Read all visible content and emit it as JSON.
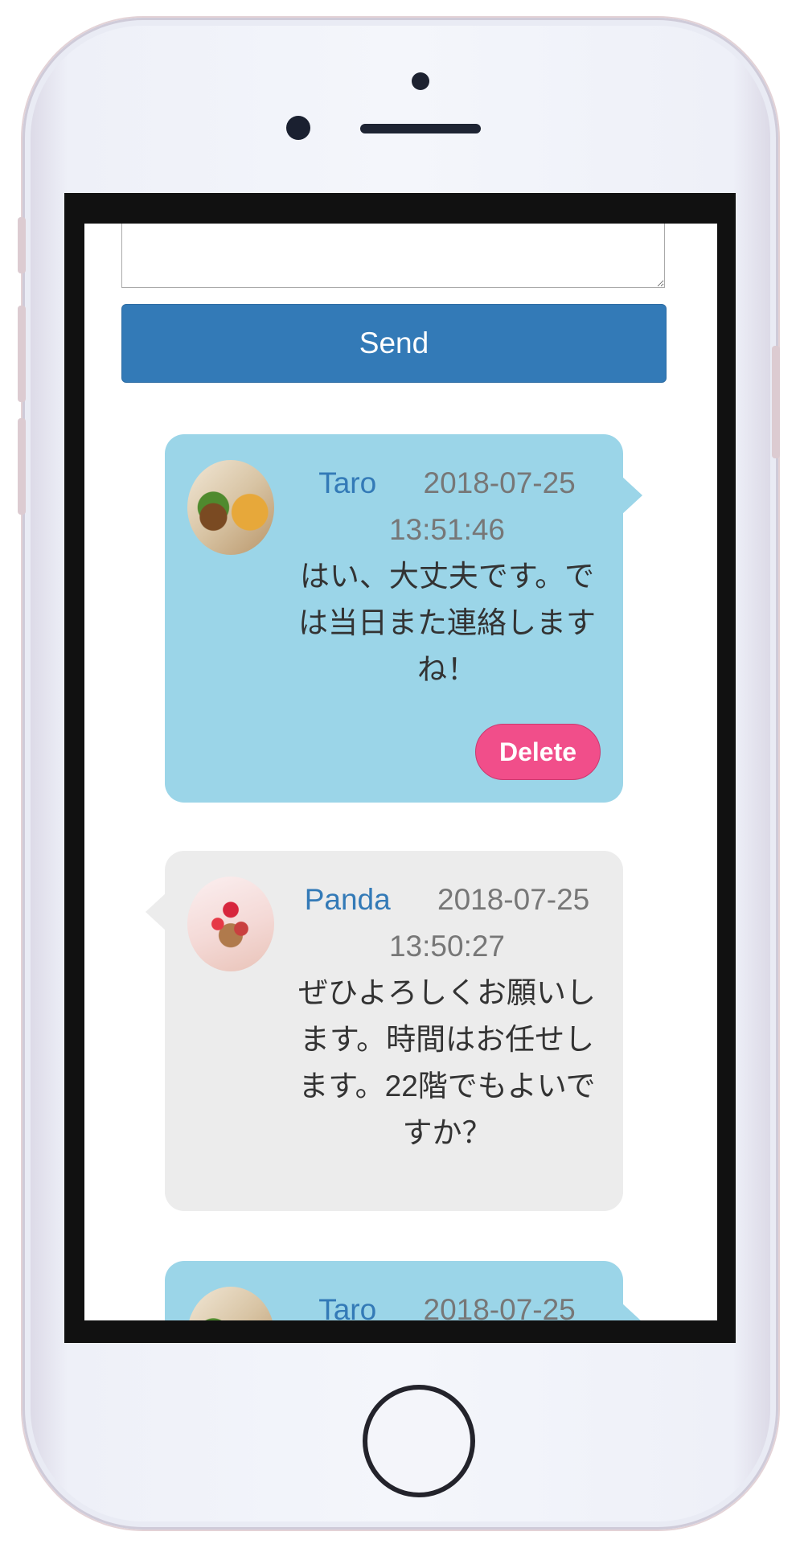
{
  "form": {
    "message_value": "",
    "send_label": "Send"
  },
  "messages": [
    {
      "sender": "Taro",
      "timestamp": "2018-07-25 13:51:46",
      "text": "はい、大丈夫です。では当日また連絡しますね！",
      "own": true,
      "avatar_icon": "burger-photo-avatar",
      "delete_label": "Delete"
    },
    {
      "sender": "Panda",
      "timestamp": "2018-07-25 13:50:27",
      "text": "ぜひよろしくお願いします。時間はお任せします。22階でもよいですか？",
      "own": false,
      "avatar_icon": "cake-photo-avatar"
    },
    {
      "sender": "Taro",
      "timestamp": "2018-07-25",
      "own": true,
      "avatar_icon": "burger-photo-avatar"
    }
  ],
  "colors": {
    "send_button": "#337ab7",
    "own_bubble": "#9bd5e8",
    "other_bubble": "#ececec",
    "delete_button": "#f14e8a",
    "sender_name": "#337ab7"
  }
}
